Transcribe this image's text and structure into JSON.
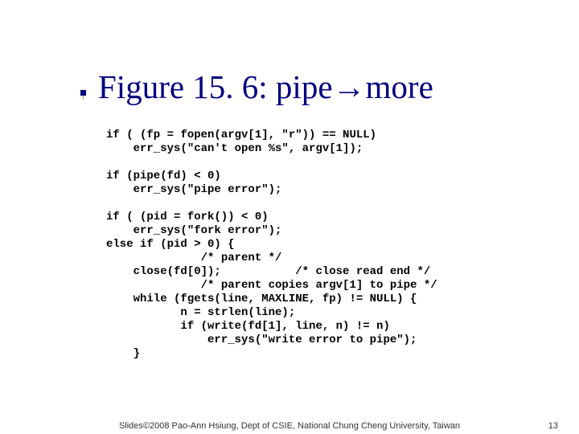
{
  "title": {
    "prefix": "Figure 15. 6: pipe",
    "suffix": "more"
  },
  "code_lines": [
    "if ( (fp = fopen(argv[1], \"r\")) == NULL)",
    "    err_sys(\"can't open %s\", argv[1]);",
    "",
    "if (pipe(fd) < 0)",
    "    err_sys(\"pipe error\");",
    "",
    "if ( (pid = fork()) < 0)",
    "    err_sys(\"fork error\");",
    "else if (pid > 0) {",
    "              /* parent */",
    "    close(fd[0]);           /* close read end */",
    "              /* parent copies argv[1] to pipe */",
    "    while (fgets(line, MAXLINE, fp) != NULL) {",
    "           n = strlen(line);",
    "           if (write(fd[1], line, n) != n)",
    "               err_sys(\"write error to pipe\");",
    "    }"
  ],
  "footer": {
    "credit": "Slides©2008 Pao-Ann Hsiung, Dept of CSIE, National Chung Cheng University, Taiwan",
    "page": "13"
  }
}
